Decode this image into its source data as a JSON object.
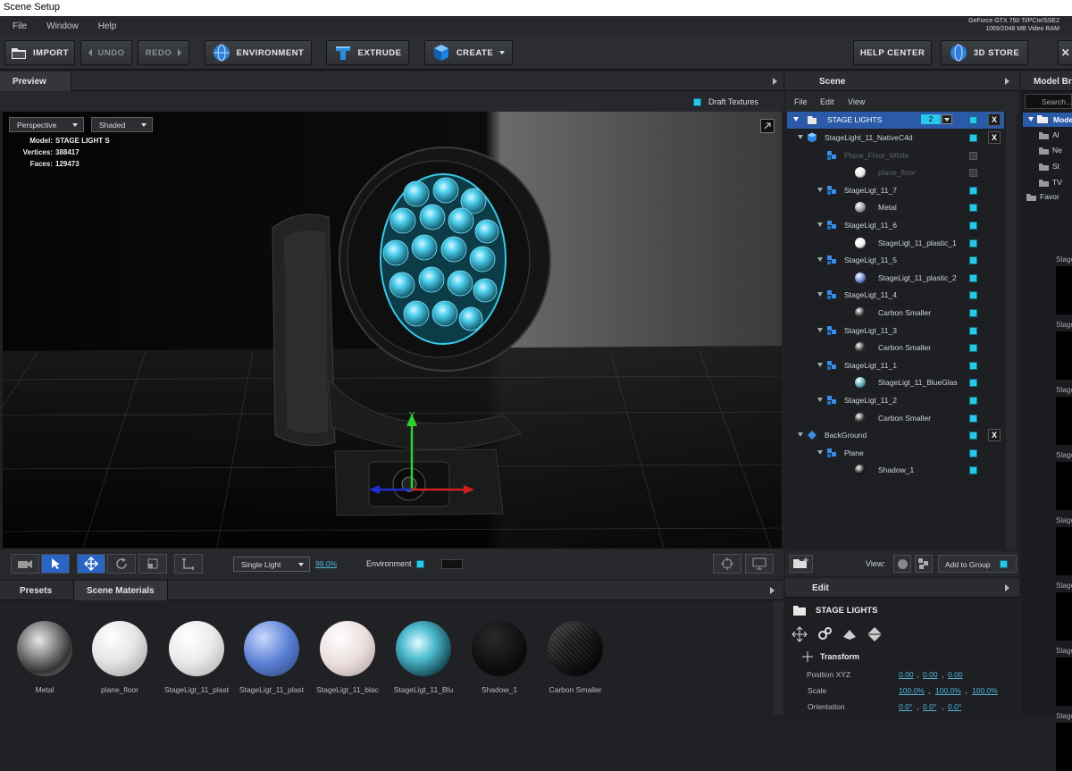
{
  "window": {
    "title": "Scene Setup"
  },
  "menu": [
    "File",
    "Window",
    "Help"
  ],
  "gpu": {
    "line1": "GeForce GTX 750 Ti/PCIe/SSE2",
    "line2": "1069/2048 MB Video RAM"
  },
  "toolbar": {
    "import": "IMPORT",
    "undo": "UNDO",
    "redo": "REDO",
    "environment": "ENVIRONMENT",
    "extrude": "EXTRUDE",
    "create": "CREATE",
    "help_center": "HELP CENTER",
    "store": "3D STORE"
  },
  "preview": {
    "tab": "Preview",
    "draft_textures": "Draft Textures",
    "draft_textures_checked": true,
    "camera": "Perspective",
    "shading": "Shaded",
    "stats": {
      "model_label": "Model:",
      "model": "STAGE LIGHT S",
      "vertices_label": "Vertices:",
      "vertices": "388417",
      "faces_label": "Faces:",
      "faces": "129473"
    },
    "light_mode": "Single Light",
    "light_pct": "99.0%",
    "environment_label": "Environment",
    "environment_checked": true
  },
  "scene": {
    "tab": "Scene",
    "menu": [
      "File",
      "Edit",
      "View"
    ],
    "root": {
      "label": "STAGE LIGHTS",
      "count": "2"
    },
    "items": [
      {
        "label": "StageLight_11_NativeC4d",
        "kind": "object",
        "depth": 1,
        "expand": true,
        "x": true
      },
      {
        "label": "Plane_Floor_White",
        "kind": "mesh",
        "depth": 2,
        "dim": true
      },
      {
        "label": "plane_floor",
        "kind": "mat",
        "depth": 3,
        "dim": true,
        "ball": "#e8e8e8"
      },
      {
        "label": "StageLigt_11_7",
        "kind": "mesh",
        "depth": 2,
        "expand": true
      },
      {
        "label": "Metal",
        "kind": "mat",
        "depth": 3,
        "ball": "#9a9a9a"
      },
      {
        "label": "StageLigt_11_6",
        "kind": "mesh",
        "depth": 2,
        "expand": true
      },
      {
        "label": "StageLigt_11_plastic_1",
        "kind": "mat",
        "depth": 3,
        "ball": "#f0f0f0"
      },
      {
        "label": "StageLigt_11_5",
        "kind": "mesh",
        "depth": 2,
        "expand": true
      },
      {
        "label": "StageLigt_11_plastic_2",
        "kind": "mat",
        "depth": 3,
        "ball": "#6a86d4"
      },
      {
        "label": "StageLigt_11_4",
        "kind": "mesh",
        "depth": 2,
        "expand": true
      },
      {
        "label": "Carbon Smaller",
        "kind": "mat",
        "depth": 3,
        "ball": "#2a2a2a"
      },
      {
        "label": "StageLigt_11_3",
        "kind": "mesh",
        "depth": 2,
        "expand": true
      },
      {
        "label": "Carbon Smaller",
        "kind": "mat",
        "depth": 3,
        "ball": "#2a2a2a"
      },
      {
        "label": "StageLigt_11_1",
        "kind": "mesh",
        "depth": 2,
        "expand": true
      },
      {
        "label": "StageLigt_11_BlueGlas",
        "kind": "mat",
        "depth": 3,
        "ball": "#5fa7b8"
      },
      {
        "label": "StageLigt_11_2",
        "kind": "mesh",
        "depth": 2,
        "expand": true
      },
      {
        "label": "Carbon Smaller",
        "kind": "mat",
        "depth": 3,
        "ball": "#2a2a2a"
      },
      {
        "label": "BackGround",
        "kind": "bg",
        "depth": 1,
        "expand": true,
        "x": true
      },
      {
        "label": "Plane",
        "kind": "mesh",
        "depth": 2,
        "expand": true
      },
      {
        "label": "Shadow_1",
        "kind": "mat",
        "depth": 3,
        "ball": "#1a1a1a"
      }
    ],
    "view_label": "View:",
    "add_to_group": "Add to Group"
  },
  "model_browser": {
    "tab": "Model Br",
    "search": "Search...",
    "tree": [
      "Mode",
      "Al",
      "Ne",
      "St",
      "TV",
      "Favor"
    ],
    "stage_labels": [
      "Stage",
      "Stage",
      "Stage",
      "Stage",
      "Stage",
      "Stage",
      "Stage",
      "Stage"
    ]
  },
  "materials": {
    "tab_presets": "Presets",
    "tab_scene": "Scene Materials",
    "items": [
      {
        "label": "Metal"
      },
      {
        "label": "plane_floor"
      },
      {
        "label": "StageLigt_11_plast"
      },
      {
        "label": "StageLigt_11_plast"
      },
      {
        "label": "StageLigt_11_blac"
      },
      {
        "label": "StageLigt_11_Blu"
      },
      {
        "label": "Shadow_1"
      },
      {
        "label": "Carbon Smaller"
      }
    ]
  },
  "edit": {
    "tab": "Edit",
    "object": "STAGE LIGHTS",
    "transform": "Transform",
    "position_label": "Position XYZ",
    "position": [
      "0.00",
      "0.00",
      "0.00"
    ],
    "scale_label": "Scale",
    "scale": [
      "100.0%",
      "100.0%",
      "100.0%"
    ],
    "orientation_label": "Orientation",
    "orientation": [
      "0.0°",
      "0.0°",
      "0.0°"
    ],
    "sep": ","
  },
  "colors": {
    "accent": "#29c7e8",
    "selection": "#2a5aa8",
    "bg": "#1e2024",
    "link": "#4fb6d8"
  }
}
